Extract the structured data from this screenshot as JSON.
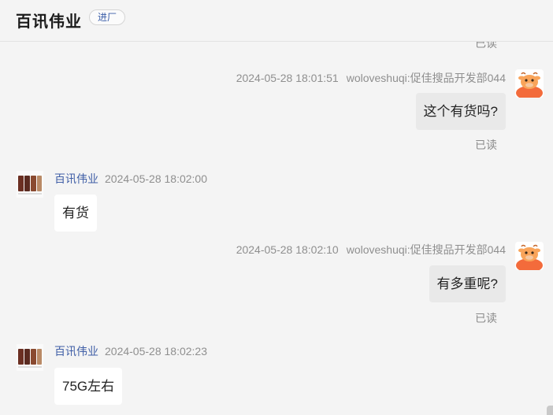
{
  "header": {
    "title": "百讯伟业",
    "badge": "进厂"
  },
  "read_label": "已读",
  "messages": [
    {
      "side": "right",
      "sender": "woloveshuqi:促佳搜品开发部044",
      "time": "2024-05-28 18:01:51",
      "text": "这个有货吗?",
      "status": "已读"
    },
    {
      "side": "left",
      "sender": "百讯伟业",
      "time": "2024-05-28 18:02:00",
      "text": "有货"
    },
    {
      "side": "right",
      "sender": "woloveshuqi:促佳搜品开发部044",
      "time": "2024-05-28 18:02:10",
      "text": "有多重呢?",
      "status": "已读"
    },
    {
      "side": "left",
      "sender": "百讯伟业",
      "time": "2024-05-28 18:02:23",
      "text": "75G左右"
    }
  ]
}
